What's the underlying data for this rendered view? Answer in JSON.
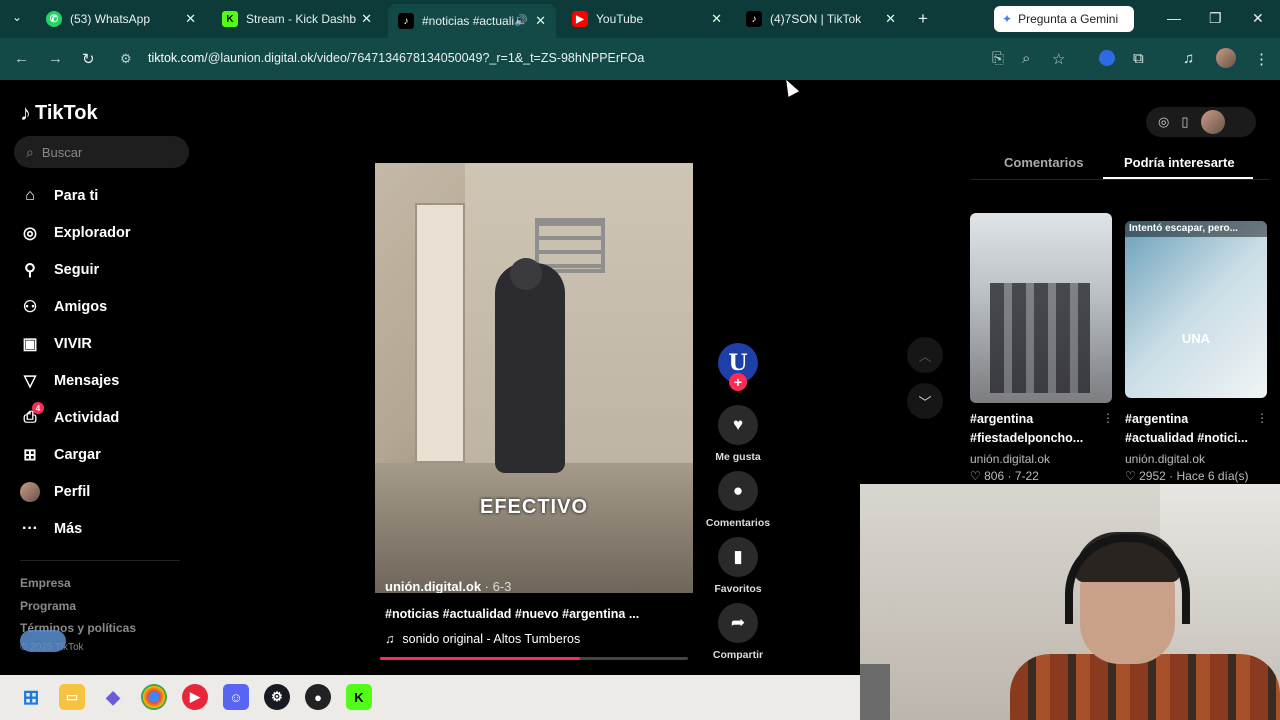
{
  "browser": {
    "tabs": [
      {
        "label": "(53) WhatsApp",
        "icon": "whatsapp-icon",
        "color": "#25d366",
        "active": false
      },
      {
        "label": "Stream - Kick Dashbo...",
        "icon": "kick-icon",
        "color": "#53fc18",
        "active": false
      },
      {
        "label": "#noticias #actuali...",
        "icon": "tiktok-icon",
        "color": "#000000",
        "active": true
      },
      {
        "label": "YouTube",
        "icon": "youtube-icon",
        "color": "#ff0000",
        "active": false
      },
      {
        "label": "(4)7SON | TikTok",
        "icon": "tiktok-icon",
        "color": "#000000",
        "active": false
      }
    ],
    "gemini_label": "Pregunta a Gemini",
    "url_host": "tiktok.com",
    "url_path": "/@launion.digital.ok/video/7647134678134050049?_r=1&_t=ZS-98hNPPErFOa"
  },
  "tiktok": {
    "logo_text": "TikTok",
    "search_placeholder": "Buscar",
    "nav": [
      {
        "label": "Para ti",
        "icon": "home-icon"
      },
      {
        "label": "Explorador",
        "icon": "compass-icon"
      },
      {
        "label": "Seguir",
        "icon": "user-follow-icon"
      },
      {
        "label": "Amigos",
        "icon": "friends-icon"
      },
      {
        "label": "VIVIR",
        "icon": "live-tv-icon"
      },
      {
        "label": "Mensajes",
        "icon": "send-icon"
      },
      {
        "label": "Actividad",
        "icon": "inbox-icon",
        "badge": "4"
      },
      {
        "label": "Cargar",
        "icon": "upload-icon"
      },
      {
        "label": "Perfil",
        "icon": "profile-avatar"
      },
      {
        "label": "Más",
        "icon": "more-icon"
      }
    ],
    "footer": {
      "company": "Empresa",
      "program": "Programa",
      "terms": "Términos y políticas",
      "copyright": "© 2025 TikTok"
    }
  },
  "video": {
    "overlay_text": "EFECTIVO",
    "author": "unión.digital.ok",
    "date": " · 6-3",
    "description": "#noticias #actualidad #nuevo #argentina ...",
    "music": "sonido original - Altos Tumberos",
    "progress_percent": 65,
    "creator_initial": "U"
  },
  "actions": {
    "like_label": "Me gusta",
    "comments_label": "Comentarios",
    "favorites_label": "Favoritos",
    "share_label": "Compartir"
  },
  "right_panel": {
    "tab_comments": "Comentarios",
    "tab_suggested": "Podría interesarte",
    "cards": [
      {
        "title_line1": "#argentina",
        "title_line2": "#fiestadelponcho...",
        "user": "unión.digital.ok",
        "likes": "806",
        "date": "7-22"
      },
      {
        "title_line1": "#argentina",
        "title_line2": "#actualidad #notici...",
        "user": "unión.digital.ok",
        "likes": "2952",
        "date": "Hace 6 día(s)",
        "overlay": "Intentó escapar, pero...",
        "center_text": "UNA"
      }
    ]
  }
}
